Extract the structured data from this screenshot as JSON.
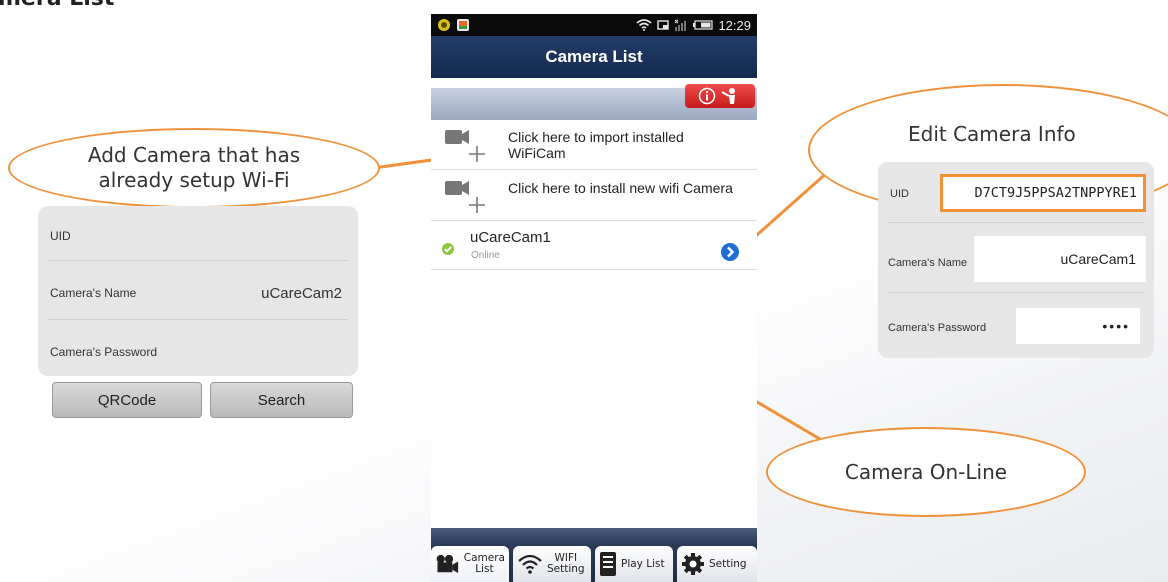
{
  "page_heading": "mera List",
  "callouts": {
    "add_camera": "Add Camera that has already setup Wi-Fi",
    "edit_info": "Edit Camera Info",
    "online": "Camera On-Line"
  },
  "add_form": {
    "uid_label": "UID",
    "uid_value": "",
    "name_label": "Camera's Name",
    "name_value": "uCareCam2",
    "password_label": "Camera's Password",
    "qrcode_button": "QRCode",
    "search_button": "Search"
  },
  "edit_form": {
    "uid_label": "UID",
    "uid_value": "D7CT9J5PPSA2TNPPYRE1",
    "name_label": "Camera's Name",
    "name_value": "uCareCam1",
    "password_label": "Camera's Password",
    "password_value": "••••"
  },
  "phone": {
    "status_time": "12:29",
    "title": "Camera List",
    "import_row": "Click here to import installed WiFiCam",
    "install_row": "Click here to install new wifi Camera",
    "camera": {
      "name": "uCareCam1",
      "status": "Online"
    },
    "tabs": [
      {
        "label_line1": "Camera",
        "label_line2": "List",
        "icon": "camera-icon",
        "active": true
      },
      {
        "label_line1": "WIFI",
        "label_line2": "Setting",
        "icon": "wifi-icon",
        "active": false
      },
      {
        "label_line1": "Play List",
        "label_line2": "",
        "icon": "document-icon",
        "active": false
      },
      {
        "label_line1": "Setting",
        "label_line2": "",
        "icon": "gear-icon",
        "active": false
      }
    ]
  },
  "colors": {
    "callout_orange": "#f0913a",
    "title_bar": "#1a3560",
    "help_red": "#d62727",
    "online_green": "#8cc63f",
    "arrow_blue": "#1e6fd1"
  }
}
